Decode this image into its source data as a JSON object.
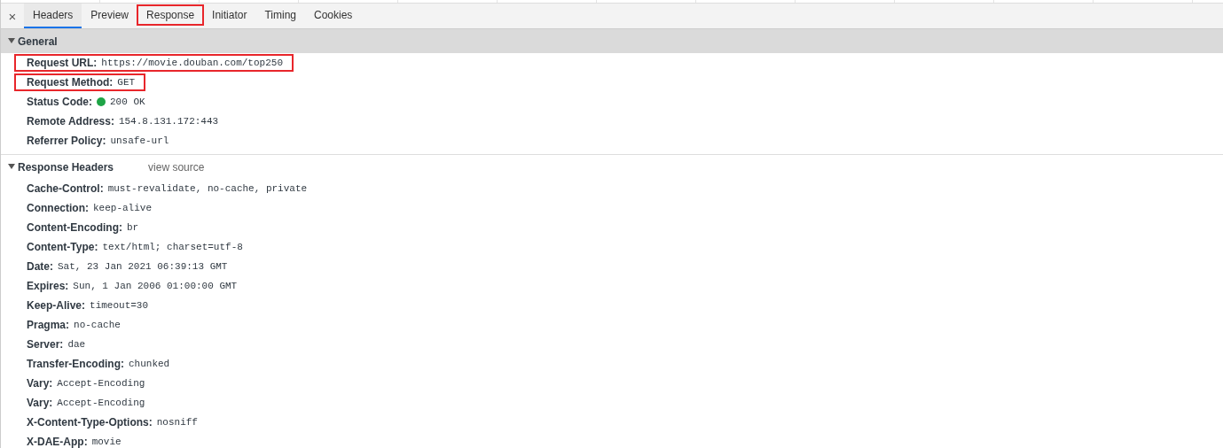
{
  "close_icon": "×",
  "tabs": [
    {
      "label": "Headers",
      "selected": true,
      "highlighted": false
    },
    {
      "label": "Preview",
      "selected": false,
      "highlighted": false
    },
    {
      "label": "Response",
      "selected": false,
      "highlighted": true
    },
    {
      "label": "Initiator",
      "selected": false,
      "highlighted": false
    },
    {
      "label": "Timing",
      "selected": false,
      "highlighted": false
    },
    {
      "label": "Cookies",
      "selected": false,
      "highlighted": false
    }
  ],
  "sections": [
    {
      "title": "General",
      "expanded": true,
      "shaded": true,
      "rows": [
        {
          "name": "Request URL:",
          "value": "https://movie.douban.com/top250",
          "highlighted": true
        },
        {
          "name": "Request Method:",
          "value": "GET",
          "highlighted": true
        },
        {
          "name": "Status Code:",
          "value": "200 OK",
          "highlighted": false,
          "color": "#1ea446"
        },
        {
          "name": "Remote Address:",
          "value": "154.8.131.172:443",
          "highlighted": false
        },
        {
          "name": "Referrer Policy:",
          "value": "unsafe-url",
          "highlighted": false
        }
      ]
    },
    {
      "title": "Response Headers",
      "link": "view source",
      "expanded": true,
      "shaded": false,
      "rows": [
        {
          "name": "Cache-Control:",
          "value": "must-revalidate, no-cache, private",
          "highlighted": false
        },
        {
          "name": "Connection:",
          "value": "keep-alive",
          "highlighted": false
        },
        {
          "name": "Content-Encoding:",
          "value": "br",
          "highlighted": false
        },
        {
          "name": "Content-Type:",
          "value": "text/html; charset=utf-8",
          "highlighted": false
        },
        {
          "name": "Date:",
          "value": "Sat, 23 Jan 2021 06:39:13 GMT",
          "highlighted": false
        },
        {
          "name": "Expires:",
          "value": "Sun, 1 Jan 2006 01:00:00 GMT",
          "highlighted": false
        },
        {
          "name": "Keep-Alive:",
          "value": "timeout=30",
          "highlighted": false
        },
        {
          "name": "Pragma:",
          "value": "no-cache",
          "highlighted": false
        },
        {
          "name": "Server:",
          "value": "dae",
          "highlighted": false
        },
        {
          "name": "Transfer-Encoding:",
          "value": "chunked",
          "highlighted": false
        },
        {
          "name": "Vary:",
          "value": "Accept-Encoding",
          "highlighted": false
        },
        {
          "name": "Vary:",
          "value": "Accept-Encoding",
          "highlighted": false
        },
        {
          "name": "X-Content-Type-Options:",
          "value": "nosniff",
          "highlighted": false
        },
        {
          "name": "X-DAE-App:",
          "value": "movie",
          "highlighted": false
        }
      ]
    }
  ]
}
